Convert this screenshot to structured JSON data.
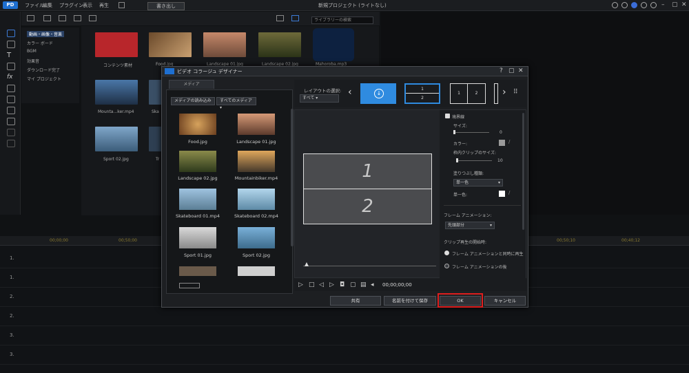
{
  "app": {
    "logo_text": "PD",
    "menus": [
      "ファイル",
      "編集",
      "プラグイン",
      "表示",
      "再生"
    ],
    "export_label": "書き出し",
    "title": "新規プロジェクト (ライトなし)",
    "window_controls": [
      "?",
      "—",
      "☐",
      "✕"
    ]
  },
  "library": {
    "search_placeholder": "ライブラリーの検索",
    "categories": [
      "動画・画像・音楽",
      "カラー ボード",
      "BGM",
      "効果音",
      "ダウンロード完了",
      "マイ プロジェクト"
    ],
    "items": [
      {
        "label": "コンテンツ素材"
      },
      {
        "label": "Food.jpg"
      },
      {
        "label": "Landscape 01.jpg"
      },
      {
        "label": "Landscape 02.jpg"
      },
      {
        "label": "Mahoroba.mp3"
      },
      {
        "label": "Mounta...ker.mp4"
      },
      {
        "label": "Ska"
      },
      {
        "label": "Sport 02.jpg"
      },
      {
        "label": "Tr"
      }
    ]
  },
  "timeline": {
    "timestamps": [
      "00;00;00",
      "00;50;00",
      "00;50;10",
      "00;40;12"
    ],
    "tracks": [
      "1.",
      "1.",
      "2.",
      "2.",
      "3.",
      "3."
    ]
  },
  "dialog": {
    "title": "ビデオ コラージュ デザイナー",
    "media_tab": "メディア",
    "import_button": "メディアの読み込み",
    "media_filter": "すべてのメディア",
    "media": [
      {
        "name": "Food.jpg"
      },
      {
        "name": "Landscape 01.jpg"
      },
      {
        "name": "Landscape 02.jpg"
      },
      {
        "name": "Mountainbiker.mp4"
      },
      {
        "name": "Skateboard 01.mp4"
      },
      {
        "name": "Skateboard 02.mp4"
      },
      {
        "name": "Sport 01.jpg"
      },
      {
        "name": "Sport 02.jpg"
      }
    ],
    "layout_label": "レイアウトの選択:",
    "layout_filter": "すべて",
    "layout_numbers": [
      "1",
      "2",
      "1",
      "2"
    ],
    "cells": [
      "1",
      "2"
    ],
    "props": {
      "border_label": "境界線",
      "size_label": "サイズ:",
      "size_value": "0",
      "color_label": "カラー:",
      "clip_size_label": "枠内クリップのサイズ:",
      "clip_size_value": "10",
      "fill_type_label": "塗りつぶし種類:",
      "fill_type_value": "単一色",
      "single_color_label": "単一色:",
      "frame_anim_label": "フレーム アニメーション:",
      "frame_anim_value": "先頭部分",
      "clip_start_label": "クリップ再生の開始時:",
      "clip_start_opt1": "フレーム アニメーションと同時に再生",
      "clip_start_opt2": "フレーム アニメーションの後"
    },
    "timecode": "00;00;00;00",
    "footer": {
      "share": "共有",
      "save_as": "名前を付けて保存",
      "ok": "OK",
      "cancel": "キャンセル"
    }
  },
  "colors": {
    "accent": "#1e6fd0",
    "highlight": "#e01e1e",
    "layout_selected": "#2f8be0"
  }
}
